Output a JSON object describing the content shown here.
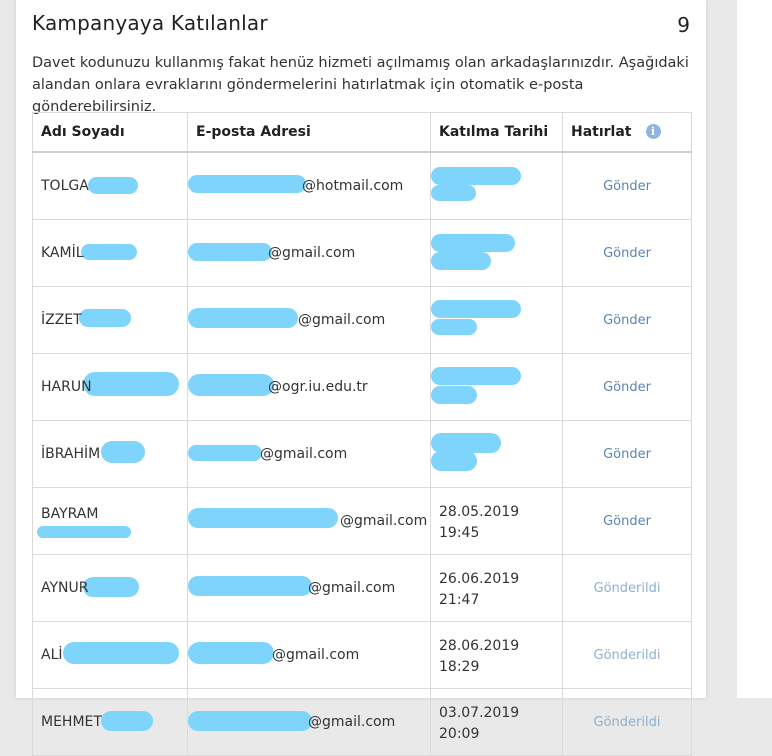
{
  "header": {
    "title": "Kampanyaya Katılanlar",
    "count": "9"
  },
  "description": "Davet kodunuzu kullanmış fakat henüz hizmeti açılmamış olan arkadaşlarınızdır. Aşağıdaki alandan onlara evraklarını göndermelerini hatırlatmak için otomatik e-posta gönderebilirsiniz.",
  "table": {
    "headers": {
      "name": "Adı Soyadı",
      "email": "E-posta Adresi",
      "date": "Katılma Tarihi",
      "remind": "Hatırlat"
    },
    "info_icon": "info-icon",
    "rows": [
      {
        "name": "TOLGA",
        "email": "@hotmail.com",
        "date1": "",
        "date2": "",
        "action": "Gönder"
      },
      {
        "name": "KAMİL",
        "email": "@gmail.com",
        "date1": "",
        "date2": "",
        "action": "Gönder"
      },
      {
        "name": "İZZET",
        "email": "@gmail.com",
        "date1": "",
        "date2": "",
        "action": "Gönder"
      },
      {
        "name": "HARUN",
        "email": "@ogr.iu.edu.tr",
        "date1": "",
        "date2": "",
        "action": "Gönder"
      },
      {
        "name": "İBRAHİM",
        "email": "@gmail.com",
        "date1": "",
        "date2": "",
        "action": "Gönder"
      },
      {
        "name": "BAYRAM",
        "email": "@gmail.com",
        "date1": "28.05.2019",
        "date2": "19:45",
        "action": "Gönder"
      },
      {
        "name": "AYNUR",
        "email": "@gmail.com",
        "date1": "26.06.2019",
        "date2": "21:47",
        "action": "Gönderildi"
      },
      {
        "name": "ALİ",
        "email": "@gmail.com",
        "date1": "28.06.2019",
        "date2": "18:29",
        "action": "Gönderildi"
      },
      {
        "name": "MEHMET",
        "email": "@gmail.com",
        "date1": "03.07.2019",
        "date2": "20:09",
        "action": "Gönderildi"
      }
    ]
  },
  "colors": {
    "redaction": "#7fd4fb",
    "link": "#5b86b0",
    "link_disabled": "#8fb0d0",
    "info_icon": "#8fb4e3"
  }
}
